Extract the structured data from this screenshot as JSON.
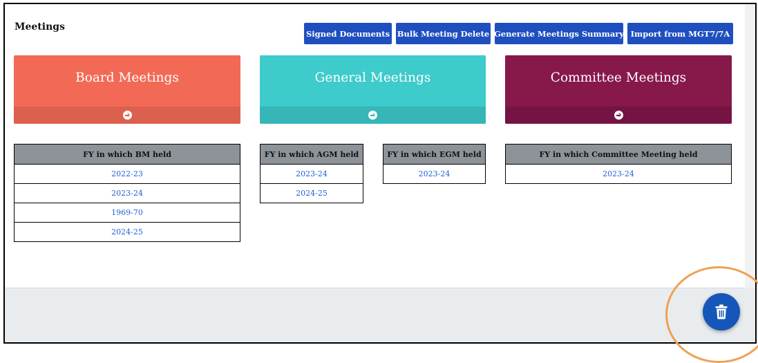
{
  "page": {
    "title": "Meetings"
  },
  "toolbar": {
    "buttons": [
      {
        "label": "Signed Documents"
      },
      {
        "label": "Bulk Meeting Delete"
      },
      {
        "label": "Generate Meetings Summary"
      },
      {
        "label": "Import from MGT7/7A"
      }
    ]
  },
  "tiles": [
    {
      "title": "Board Meetings",
      "color": "#f26a55",
      "footer_color": "#dc604e",
      "icon": "arrow-right-circle-icon"
    },
    {
      "title": "General Meetings",
      "color": "#3ecbcb",
      "footer_color": "#36b6b6",
      "icon": "arrow-right-circle-icon"
    },
    {
      "title": "Committee Meetings",
      "color": "#87184a",
      "footer_color": "#751342",
      "icon": "arrow-right-circle-icon"
    }
  ],
  "tables": {
    "bm": {
      "header": "FY in which BM held",
      "rows": [
        "2022-23",
        "2023-24",
        "1969-70",
        "2024-25"
      ]
    },
    "agm": {
      "header": "FY in which AGM held",
      "rows": [
        "2023-24",
        "2024-25"
      ]
    },
    "egm": {
      "header": "FY in which EGM held",
      "rows": [
        "2023-24"
      ]
    },
    "committee": {
      "header": "FY in which Committee Meeting held",
      "rows": [
        "2023-24"
      ]
    }
  },
  "fab": {
    "icon": "trash-icon",
    "color": "#1557b8"
  },
  "colors": {
    "button": "#1f4fbf",
    "link": "#2060d6",
    "highlight_ring": "#f0a050"
  }
}
